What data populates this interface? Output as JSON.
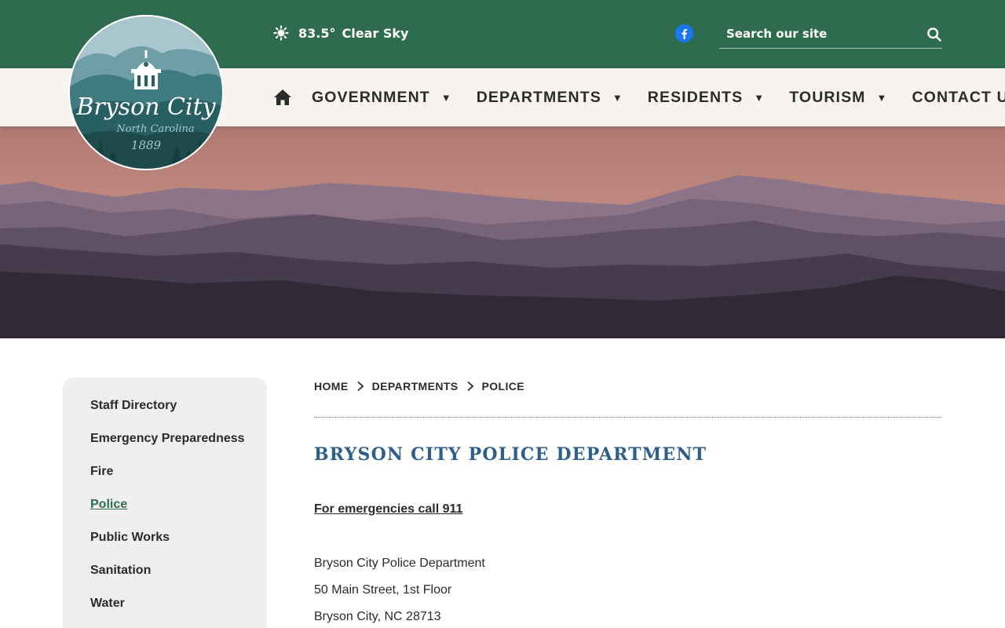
{
  "header": {
    "weather": {
      "temperature": "83.5°",
      "condition": "Clear Sky",
      "icon": "sun-icon"
    },
    "social_icon": "facebook-icon",
    "search": {
      "placeholder": "Search our site",
      "icon": "search-icon"
    }
  },
  "logo": {
    "name": "Bryson City",
    "state": "North Carolina",
    "year": "1889"
  },
  "nav": {
    "home_icon": "home-icon",
    "items": [
      {
        "label": "GOVERNMENT",
        "caret": "▼"
      },
      {
        "label": "DEPARTMENTS",
        "caret": "▼"
      },
      {
        "label": "RESIDENTS",
        "caret": "▼"
      },
      {
        "label": "TOURISM",
        "caret": "▼"
      },
      {
        "label": "CONTACT US"
      }
    ]
  },
  "sidebar": {
    "items": [
      {
        "label": "Staff Directory"
      },
      {
        "label": "Emergency Preparedness"
      },
      {
        "label": "Fire"
      },
      {
        "label": "Police",
        "active": true
      },
      {
        "label": "Public Works"
      },
      {
        "label": "Sanitation"
      },
      {
        "label": "Water"
      }
    ]
  },
  "breadcrumb": [
    "HOME",
    "DEPARTMENTS",
    "POLICE"
  ],
  "main": {
    "title": "BRYSON CITY POLICE DEPARTMENT",
    "emergency": "For emergencies call 911",
    "address": [
      "Bryson City Police Department",
      "50 Main Street, 1st Floor",
      "Bryson City, NC 28713"
    ]
  },
  "colors": {
    "header_green": "#2f6b4f",
    "nav_bg": "#f7f3ef",
    "title_blue": "#2e5f8a",
    "sidebar_bg": "#efefef"
  }
}
